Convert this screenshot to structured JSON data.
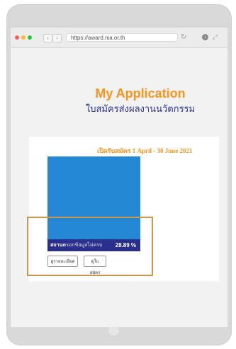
{
  "browser": {
    "url": "https://award.nia.or.th",
    "nav_back": "‹",
    "nav_forward": "›",
    "reload_icon": "reload-icon",
    "download_icon": "download-icon",
    "fullscreen_icon": "fullscreen-icon"
  },
  "hero": {
    "title": "My Application",
    "subtitle": "ใบสมัครส่งผลงานนวัตกรรม"
  },
  "application_card": {
    "period": "เปิดรับสมัคร 1 April - 30 June 2021",
    "status_label": "สถานะ",
    "status_value": "กรอกข้อมูลไม่ครบ",
    "progress_percent": "28.89 %",
    "details_button": "ดูรายละเอียด",
    "form_button": "ดูใบสมัคร"
  },
  "colors": {
    "accent_orange": "#f7941d",
    "brand_blue": "#2e3192",
    "image_blue": "#2387d4",
    "highlight_border": "#c9974f"
  }
}
